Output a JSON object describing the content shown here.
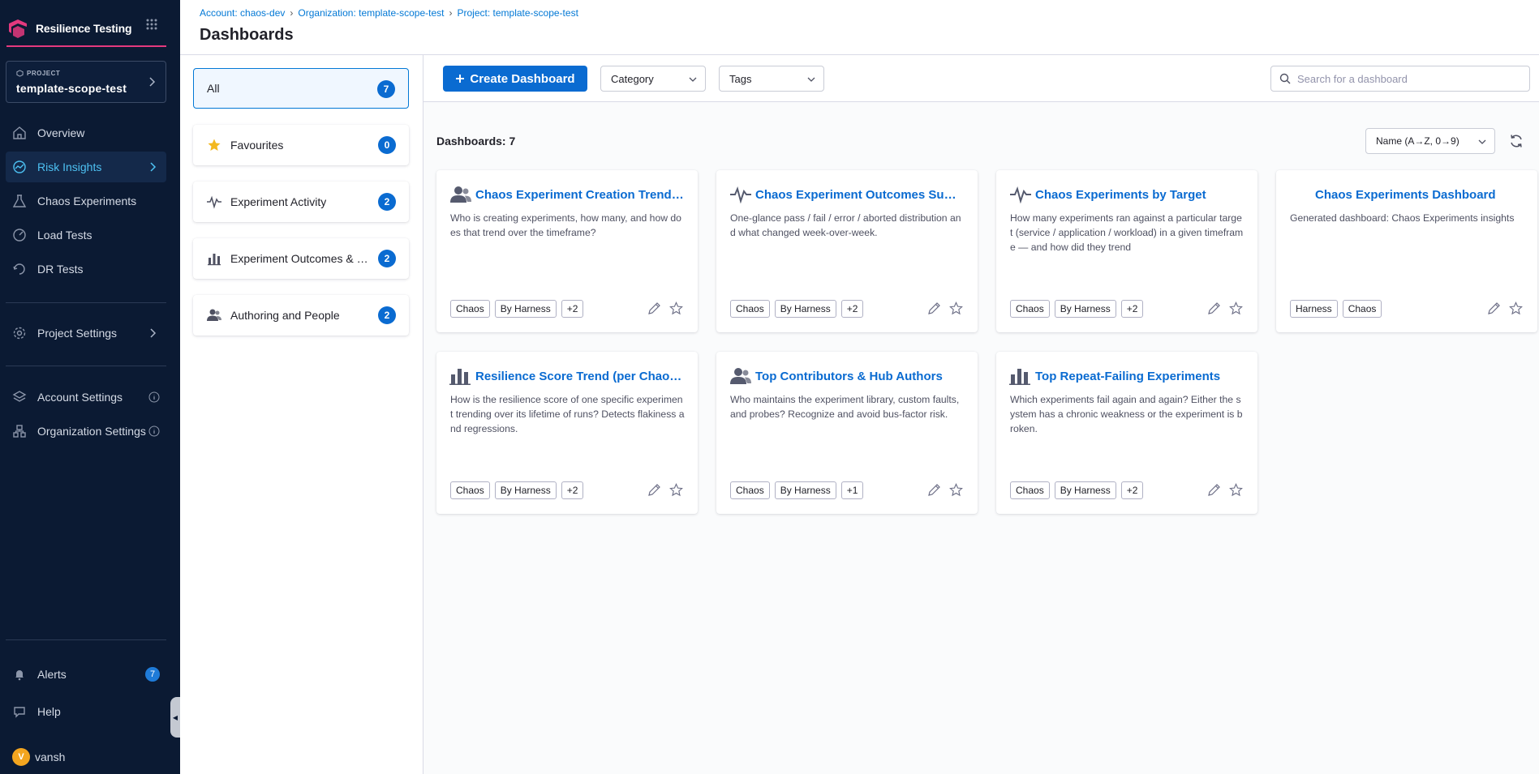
{
  "sidebar": {
    "brand": "Resilience Testing",
    "project_label": "PROJECT",
    "project_name": "template-scope-test",
    "nav": [
      {
        "label": "Overview"
      },
      {
        "label": "Risk Insights"
      },
      {
        "label": "Chaos Experiments"
      },
      {
        "label": "Load Tests"
      },
      {
        "label": "DR Tests"
      }
    ],
    "project_settings": "Project Settings",
    "account_settings": "Account Settings",
    "org_settings": "Organization Settings",
    "alerts": "Alerts",
    "alerts_count": "7",
    "help": "Help",
    "user_initial": "V",
    "user_name": "vansh"
  },
  "header": {
    "breadcrumb": [
      "Account: chaos-dev",
      "Organization: template-scope-test",
      "Project: template-scope-test"
    ],
    "title": "Dashboards"
  },
  "filters": [
    {
      "label": "All",
      "count": "7"
    },
    {
      "label": "Favourites",
      "count": "0"
    },
    {
      "label": "Experiment Activity",
      "count": "2"
    },
    {
      "label": "Experiment Outcomes & Scoring",
      "count": "2"
    },
    {
      "label": "Authoring and People",
      "count": "2"
    }
  ],
  "toolbar": {
    "create_label": "Create Dashboard",
    "category_label": "Category",
    "tags_label": "Tags",
    "search_placeholder": "Search for a dashboard"
  },
  "list": {
    "count_label": "Dashboards: 7",
    "sort_label": "Name (A→Z, 0→9)"
  },
  "cards": [
    {
      "title": "Chaos Experiment Creation Trend by Author",
      "desc": "Who is creating experiments, how many, and how does that trend over the timeframe?",
      "tags": [
        "Chaos",
        "By Harness",
        "+2"
      ]
    },
    {
      "title": "Chaos Experiment Outcomes Summary",
      "desc": "One-glance pass / fail / error / aborted distribution and what changed week-over-week.",
      "tags": [
        "Chaos",
        "By Harness",
        "+2"
      ]
    },
    {
      "title": "Chaos Experiments by Target",
      "desc": "How many experiments ran against a particular target (service / application / workload) in a given timeframe — and how did they trend",
      "tags": [
        "Chaos",
        "By Harness",
        "+2"
      ]
    },
    {
      "title": "Chaos Experiments Dashboard",
      "desc": "Generated dashboard: Chaos Experiments insights",
      "tags": [
        "Harness",
        "Chaos"
      ]
    },
    {
      "title": "Resilience Score Trend (per Chaos Experiment)",
      "desc": "How is the resilience score of one specific experiment trending over its lifetime of runs? Detects flakiness and regressions.",
      "tags": [
        "Chaos",
        "By Harness",
        "+2"
      ]
    },
    {
      "title": "Top Contributors & Hub Authors",
      "desc": "Who maintains the experiment library, custom faults, and probes? Recognize and avoid bus-factor risk.",
      "tags": [
        "Chaos",
        "By Harness",
        "+1"
      ]
    },
    {
      "title": "Top Repeat-Failing Experiments",
      "desc": "Which experiments fail again and again? Either the system has a chronic weakness or the experiment is broken.",
      "tags": [
        "Chaos",
        "By Harness",
        "+2"
      ]
    }
  ]
}
